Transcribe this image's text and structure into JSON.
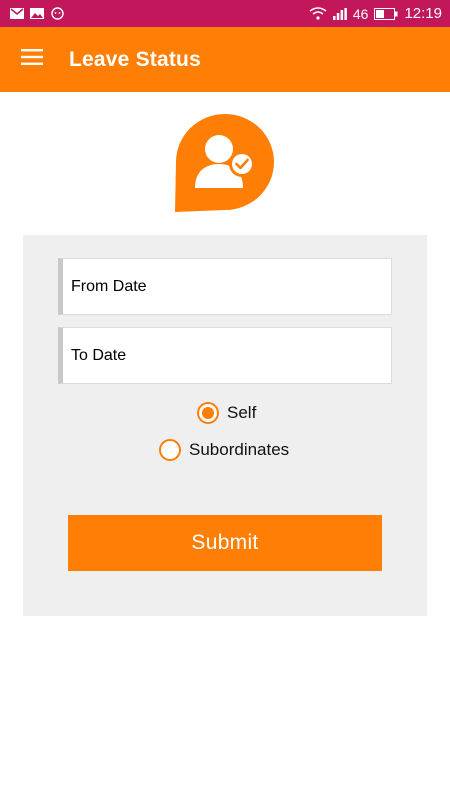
{
  "status_bar": {
    "network": "46",
    "time": "12:19",
    "icons": [
      "gmail-icon",
      "image-icon",
      "emoji-icon",
      "wifi-icon",
      "signal-icon",
      "battery-icon"
    ]
  },
  "app_bar": {
    "title": "Leave Status",
    "menu_icon": "hamburger-menu-icon"
  },
  "logo": {
    "icon": "user-check-bubble-icon"
  },
  "form": {
    "from_date_placeholder": "From Date",
    "to_date_placeholder": "To Date",
    "radio_options": [
      {
        "label": "Self",
        "selected": true
      },
      {
        "label": "Subordinates",
        "selected": false
      }
    ],
    "submit_label": "Submit"
  },
  "colors": {
    "accent": "#ff7f06",
    "status_bar": "#c2185b",
    "panel_bg": "#efefef"
  }
}
